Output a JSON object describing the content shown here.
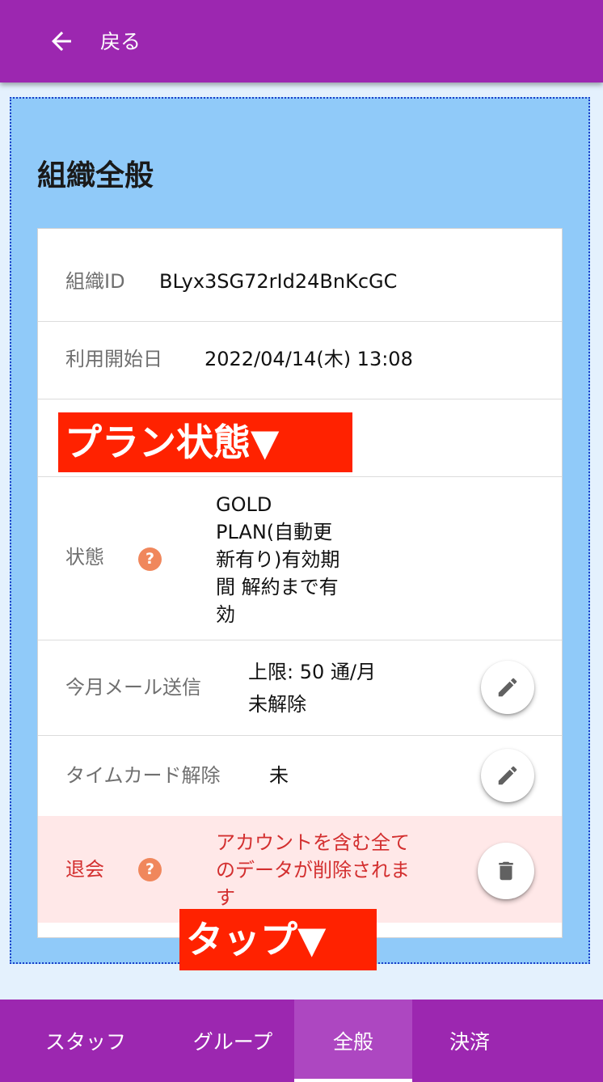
{
  "header": {
    "back_label": "戻る"
  },
  "section_title": "組織全般",
  "org": {
    "id_label": "組織ID",
    "id_value": "BLyx3SG72rId24BnKcGC",
    "start_label": "利用開始日",
    "start_value": "2022/04/14(木) 13:08",
    "status_label": "状態",
    "status_value_lines": [
      "GOLD",
      "PLAN(自動更",
      "新有り)有効期",
      "間 解約まで有",
      "効"
    ],
    "mail_label": "今月メール送信",
    "mail_value_lines": [
      "上限: 50 通/月",
      "未解除"
    ],
    "timecard_label": "タイムカード解除",
    "timecard_value": "未",
    "withdraw_label": "退会",
    "withdraw_value_lines": [
      "アカウントを含む全て",
      "のデータが削除されま",
      "す"
    ],
    "help_icon_glyph": "?"
  },
  "annotations": {
    "plan_status": "プラン状態▼",
    "tap": "タップ▼"
  },
  "bottom_nav": {
    "tabs": [
      {
        "label": "スタッフ"
      },
      {
        "label": "グループ"
      },
      {
        "label": "全般"
      },
      {
        "label": "決済"
      }
    ],
    "active_index": 2
  },
  "colors": {
    "appbar": "#9c27b0",
    "content_bg": "#90caf9",
    "danger_row_bg": "#ffe8e8",
    "danger_text": "#d32f2f",
    "help_icon": "#f0875c",
    "annotation_bg": "#ff2200"
  },
  "icons": [
    "arrow-back-icon",
    "help-icon",
    "pencil-icon",
    "trash-icon"
  ]
}
